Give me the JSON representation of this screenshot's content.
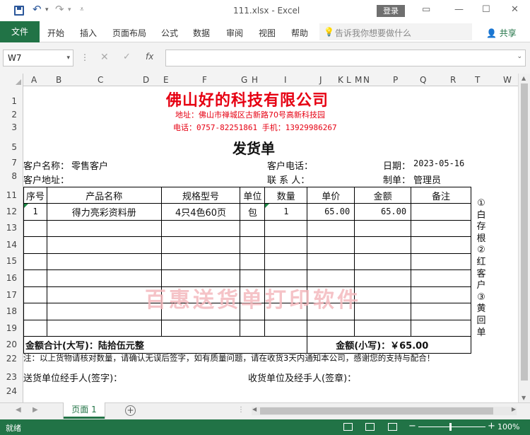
{
  "titlebar": {
    "document_title": "111.xlsx  -  Excel",
    "login_label": "登录"
  },
  "ribbon": {
    "file_label": "文件",
    "tabs": [
      "开始",
      "插入",
      "页面布局",
      "公式",
      "数据",
      "审阅",
      "视图",
      "帮助"
    ],
    "tellme_placeholder": "告诉我你想要做什么",
    "share_label": "共享"
  },
  "formula_bar": {
    "name_box": "W7",
    "fx_label": "fx",
    "formula": ""
  },
  "grid": {
    "columns": [
      "A",
      "B",
      "C",
      "D",
      "E",
      "F",
      "G",
      "H",
      "I",
      "J",
      "K",
      "L",
      "M",
      "N",
      "P",
      "Q",
      "R",
      "T",
      "W"
    ],
    "rows": [
      "1",
      "2",
      "3",
      "5",
      "7",
      "8",
      "11",
      "12",
      "13",
      "14",
      "15",
      "16",
      "17",
      "18",
      "19",
      "20",
      "22",
      "23",
      "24"
    ]
  },
  "document": {
    "company": "佛山好的科技有限公司",
    "address": "地址：佛山市禅城区古新路70号高新科技园",
    "phone": "电话：0757-82251861  手机：13929986267",
    "doc_type": "发货单",
    "customer_name_label": "客户名称：",
    "customer_name": "零售客户",
    "customer_phone_label": "客户电话：",
    "date_label": "日期：",
    "date": "2023-05-16",
    "customer_address_label": "客户地址：",
    "contact_label": "联  系  人：",
    "maker_label": "制单：",
    "maker": "管理员",
    "table_headers": [
      "序号",
      "产品名称",
      "规格型号",
      "单位",
      "数量",
      "单价",
      "金额",
      "备注"
    ],
    "items": [
      {
        "no": "1",
        "name": "得力亮彩资料册",
        "spec": "4只4色60页",
        "unit": "包",
        "qty": "1",
        "price": "65.00",
        "amount": "65.00",
        "remark": ""
      }
    ],
    "total_upper_label": "金额合计(大写)：",
    "total_upper": "陆拾伍元整",
    "total_lower_label": "金额(小写)：",
    "total_lower": "￥65.00",
    "copies_text": [
      "①",
      "白",
      "存",
      "根",
      "②",
      "红",
      "客",
      "户",
      "③",
      "黄",
      "回",
      "单"
    ],
    "watermark": "百惠送货单打印软件",
    "note": "注：以上货物请核对数量，请确认无误后签字，如有质量问题，请在收货3天内通知本公司，感谢您的支持与配合！",
    "sender_sign_label": "送货单位经手人(签字)：",
    "receiver_sign_label": "收货单位及经手人(签章)："
  },
  "sheet_tabs": {
    "active": "页面 1"
  },
  "statusbar": {
    "status": "就绪",
    "zoom": "100%"
  }
}
